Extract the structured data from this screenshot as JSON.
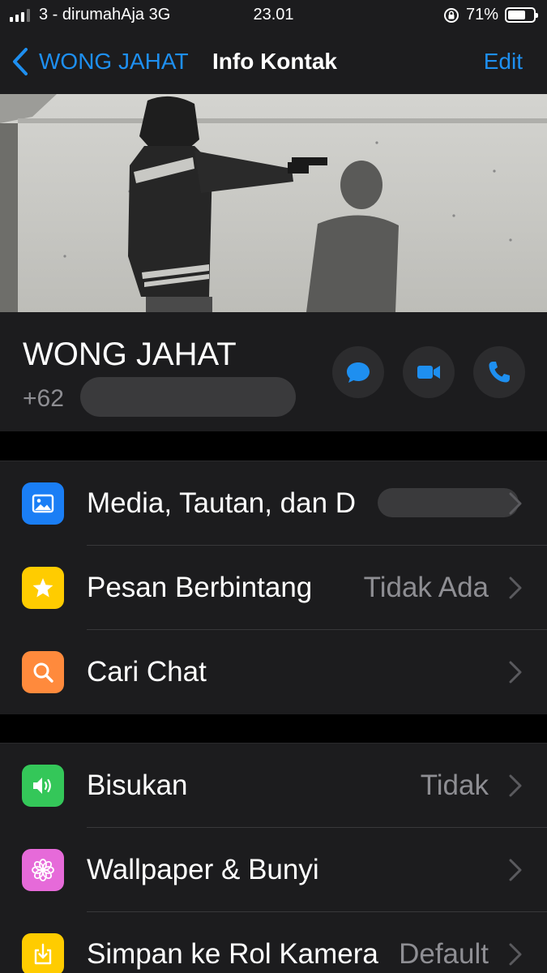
{
  "status_bar": {
    "carrier": "3 - dirumahAja  3G",
    "time": "23.01",
    "battery_percent": "71%",
    "battery_level": 0.71,
    "signal_bars": 3,
    "signal_max": 4
  },
  "nav": {
    "back_label": "WONG JAHAT",
    "title": "Info Kontak",
    "edit_label": "Edit"
  },
  "contact": {
    "name": "WONG JAHAT",
    "phone_prefix": "+62"
  },
  "actions": {
    "message_icon": "message-icon",
    "video_icon": "video-call-icon",
    "phone_icon": "phone-call-icon"
  },
  "group1": [
    {
      "label": "Media, Tautan, dan D",
      "value": "",
      "icon": "photo-icon",
      "color": "#1a7ef5"
    },
    {
      "label": "Pesan Berbintang",
      "value": "Tidak Ada",
      "icon": "star-icon",
      "color": "#ffcc00"
    },
    {
      "label": "Cari Chat",
      "value": "",
      "icon": "search-icon",
      "color": "#ff8a3c"
    }
  ],
  "group2": [
    {
      "label": "Bisukan",
      "value": "Tidak",
      "icon": "speaker-icon",
      "color": "#34c759"
    },
    {
      "label": "Wallpaper & Bunyi",
      "value": "",
      "icon": "flower-icon",
      "color": "#e66ad9"
    },
    {
      "label": "Simpan ke Rol Kamera",
      "value": "Default",
      "icon": "download-icon",
      "color": "#ffcc00"
    }
  ],
  "colors": {
    "accent": "#1e8ff0",
    "background": "#000000",
    "cell": "#1c1c1e",
    "secondary_text": "#8e8e93"
  }
}
